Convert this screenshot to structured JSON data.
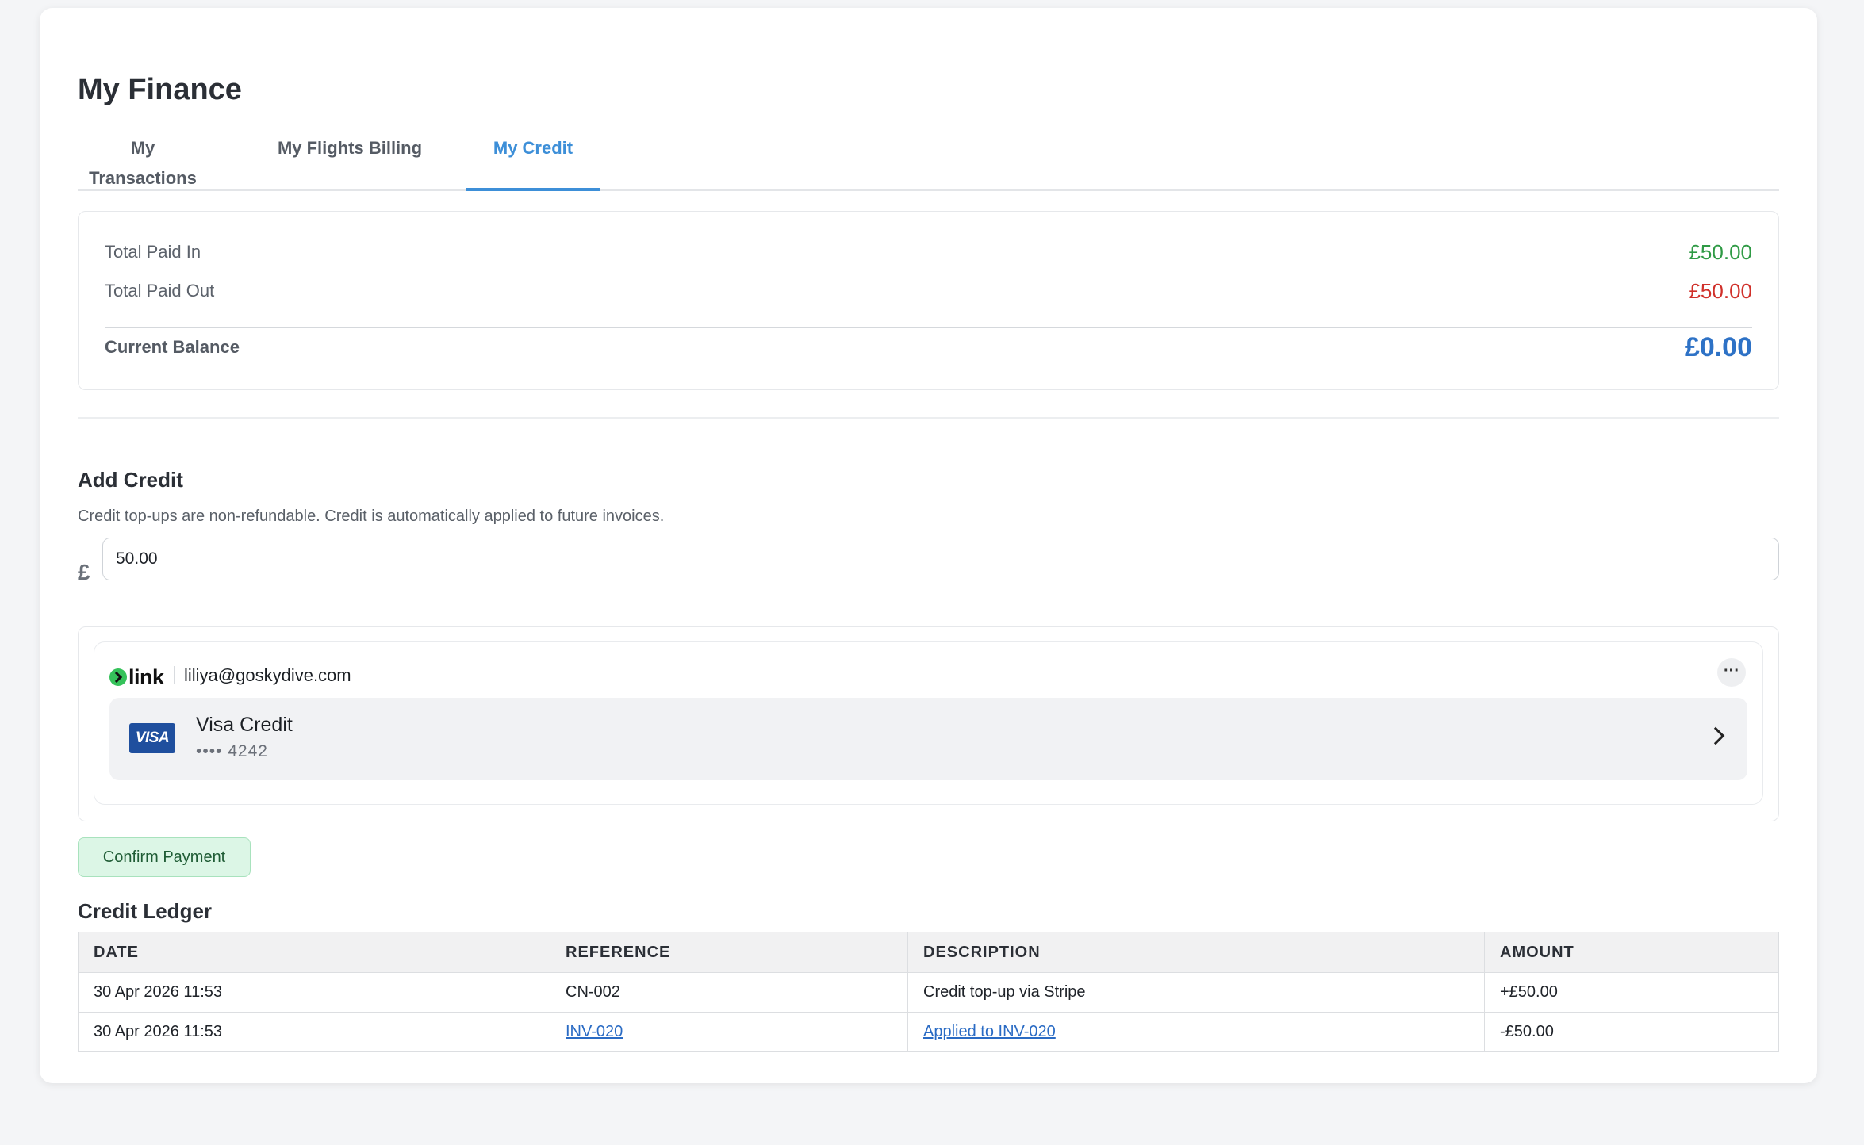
{
  "page": {
    "title": "My Finance"
  },
  "tabs": [
    {
      "label": "My Transactions",
      "active": false
    },
    {
      "label": "My Flights Billing",
      "active": false
    },
    {
      "label": "My Credit",
      "active": true
    }
  ],
  "summary": {
    "paid_in_label": "Total Paid In",
    "paid_in_value": "£50.00",
    "paid_out_label": "Total Paid Out",
    "paid_out_value": "£50.00",
    "balance_label": "Current Balance",
    "balance_value": "£0.00"
  },
  "add_credit": {
    "title": "Add Credit",
    "description": "Credit top-ups are non-refundable. Credit is automatically applied to future invoices.",
    "currency_symbol": "£",
    "amount_value": "50.00"
  },
  "payment": {
    "provider": "link",
    "email": "liliya@goskydive.com",
    "more_label": "···",
    "card_brand_badge": "VISA",
    "card_name": "Visa Credit",
    "card_number": "•••• 4242"
  },
  "confirm_label": "Confirm Payment",
  "ledger": {
    "title": "Credit Ledger",
    "columns": [
      "DATE",
      "REFERENCE",
      "DESCRIPTION",
      "AMOUNT"
    ],
    "rows": [
      {
        "date": "30 Apr 2026 11:53",
        "reference": "CN-002",
        "description": "Credit top-up via Stripe",
        "amount": "+£50.00"
      },
      {
        "date": "30 Apr 2026 11:53",
        "reference": "INV-020",
        "description": "Applied to INV-020",
        "amount": "-£50.00"
      }
    ]
  },
  "colors": {
    "accent": "#3d8fd8",
    "positive": "#2f9a45",
    "negative": "#d0302a",
    "balance": "#2e72c6",
    "confirm_bg": "#dcf6e6"
  }
}
